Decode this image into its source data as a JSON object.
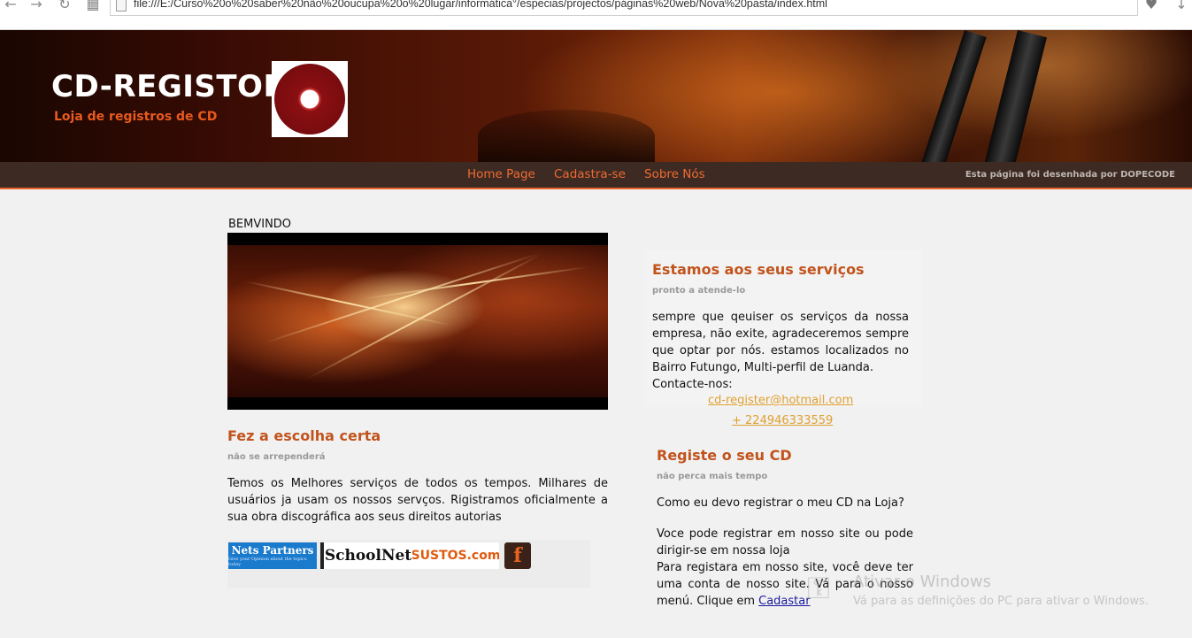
{
  "browser": {
    "url": "file:///E:/Curso%20o%20saber%20não%20oucupa%20o%20lugar/informática°/especias/projectos/páginas%20web/Nova%20pasta/index.html",
    "back_icon": "arrow-left-icon",
    "forward_icon": "arrow-right-icon",
    "reload_icon": "reload-icon",
    "apps_icon": "grid-icon"
  },
  "header": {
    "title": "CD-REGISTOR",
    "subtitle": "Loja de registros de CD"
  },
  "nav": {
    "items": [
      {
        "label": "Home Page"
      },
      {
        "label": "Cadastra-se"
      },
      {
        "label": "Sobre Nós"
      }
    ],
    "credit": "Esta página foi desenhada por DOPECODE"
  },
  "main": {
    "welcome": "BEMVINDO",
    "left": {
      "heading": "Fez a escolha certa",
      "subheading": "não se arrependerá",
      "body": "Temos os Melhores serviços de todos os tempos. Milhares de usuários ja usam os nossos servços. Rigistramos oficialmente a sua obra discográfica aos seus direitos autorias",
      "partners": [
        {
          "name": "Nets Partners",
          "tagline": "Give your Opinion about the topics today"
        },
        {
          "name": "SchoolNet"
        },
        {
          "name": "SUSTOS.com"
        },
        {
          "name": "f"
        }
      ]
    },
    "services": {
      "heading": "Estamos aos seus serviços",
      "subheading": "pronto a atende-lo",
      "body": "sempre que qeuiser os serviços da nossa empresa, não exite, agradeceremos sempre que optar por nós. estamos localizados no Bairro Futungo, Multi-perfil de Luanda.",
      "contact_label": "Contacte-nos:",
      "email": "cd-register@hotmail.com",
      "phone": "+ 224946333559"
    },
    "register": {
      "heading": "Registe o seu CD",
      "subheading": "não perca mais tempo",
      "question": "Como eu devo registrar o meu CD na Loja?",
      "answer1": "Voce pode registrar em nosso site ou pode dirigir-se em nossa loja",
      "answer2": "Para registara em nosso site, você deve ter uma conta de nosso site. Vá para o nosso menú. Clique em",
      "link": "Cadastar"
    }
  },
  "watermark": {
    "title": "Ativar o Windows",
    "subtitle": "Vá para as definições do PC para ativar o Windows."
  }
}
